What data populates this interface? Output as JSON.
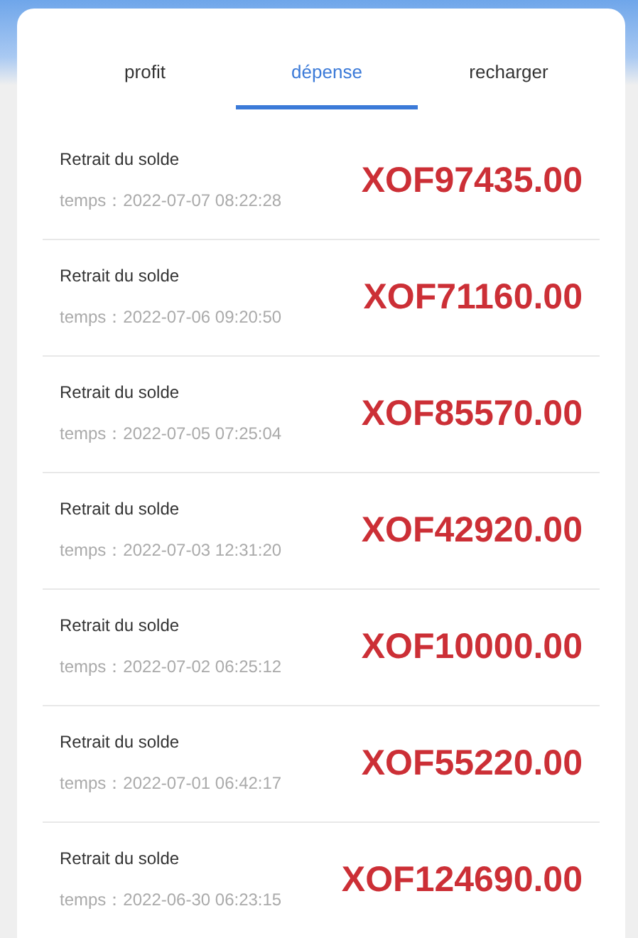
{
  "tabs": [
    {
      "label": "profit",
      "selected": false
    },
    {
      "label": "dépense",
      "selected": true
    },
    {
      "label": "recharger",
      "selected": false
    }
  ],
  "transactions": [
    {
      "label": "Retrait du solde",
      "time": "temps：2022-07-07 08:22:28",
      "amount": "XOF97435.00"
    },
    {
      "label": "Retrait du solde",
      "time": "temps：2022-07-06 09:20:50",
      "amount": "XOF71160.00"
    },
    {
      "label": "Retrait du solde",
      "time": "temps：2022-07-05 07:25:04",
      "amount": "XOF85570.00"
    },
    {
      "label": "Retrait du solde",
      "time": "temps：2022-07-03 12:31:20",
      "amount": "XOF42920.00"
    },
    {
      "label": "Retrait du solde",
      "time": "temps：2022-07-02 06:25:12",
      "amount": "XOF10000.00"
    },
    {
      "label": "Retrait du solde",
      "time": "temps：2022-07-01 06:42:17",
      "amount": "XOF55220.00"
    },
    {
      "label": "Retrait du solde",
      "time": "temps：2022-06-30 06:23:15",
      "amount": "XOF124690.00"
    }
  ]
}
